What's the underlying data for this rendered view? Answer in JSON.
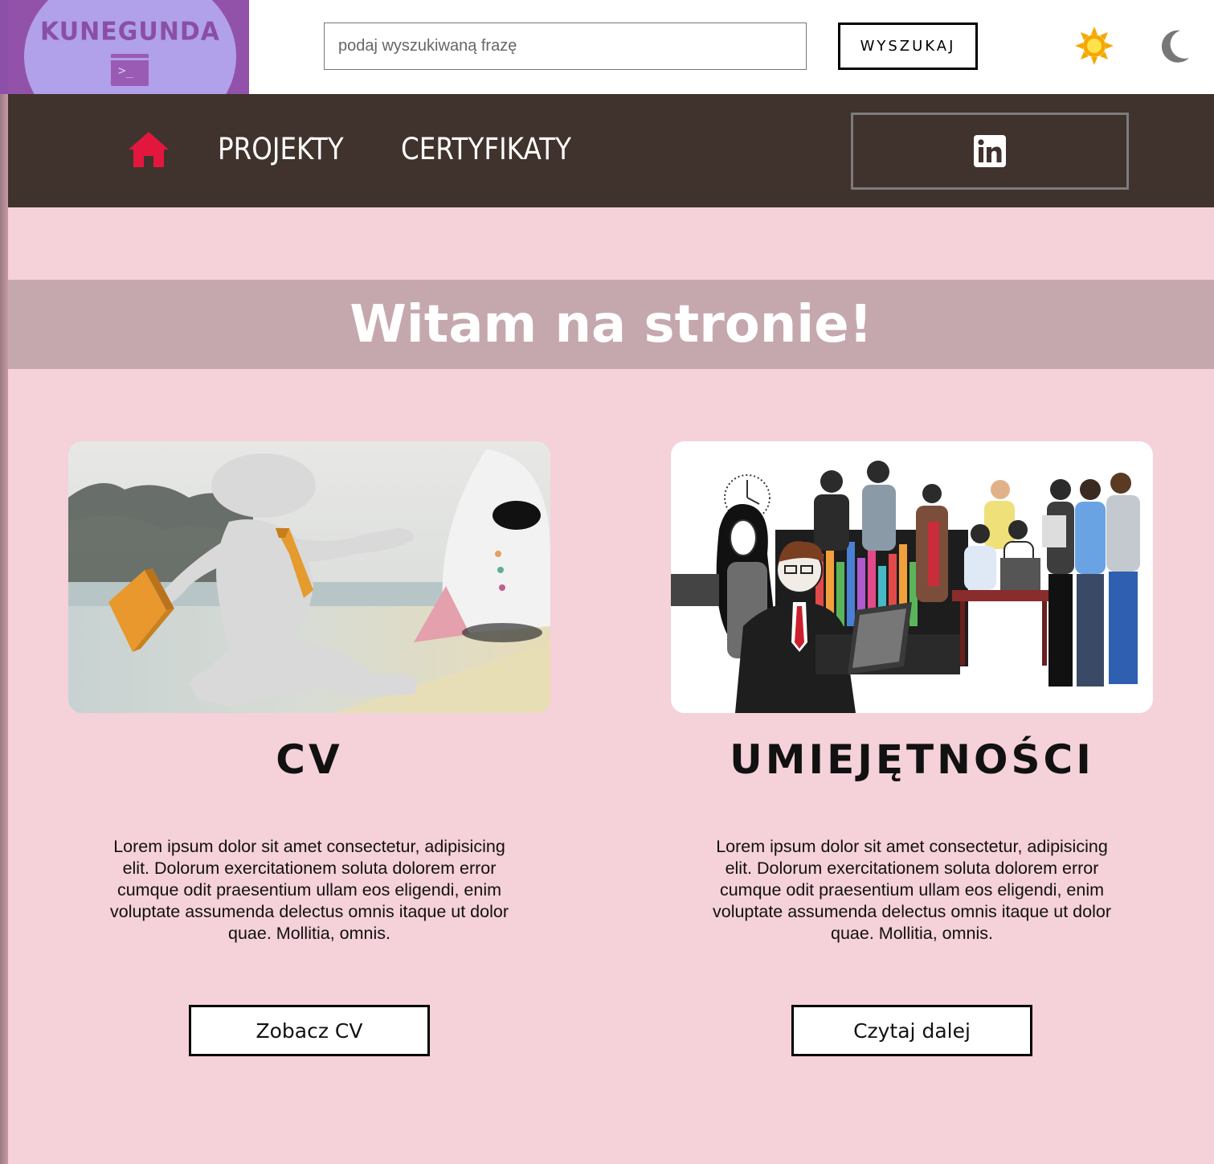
{
  "header": {
    "logo_text": "KUNEGUNDA",
    "logo_icon": "terminal-icon",
    "search": {
      "placeholder": "podaj wyszukiwaną frazę",
      "value": ""
    },
    "search_button_label": "WYSZUKAJ",
    "theme_icons": [
      "sun-icon",
      "moon-icon"
    ]
  },
  "nav": {
    "home_icon": "home-icon",
    "links": [
      {
        "label": "PROJEKTY"
      },
      {
        "label": "CERTYFIKATY"
      }
    ],
    "social_icon": "linkedin-icon"
  },
  "hero": {
    "title": "Witam na stronie!"
  },
  "cards": [
    {
      "title": "CV",
      "text": "Lorem ipsum dolor sit amet consectetur, adipisicing elit. Dolorum exercitationem soluta dolorem error cumque odit praesentium ullam eos eligendi, enim voluptate assumenda delectus omnis itaque ut dolor quae. Mollitia, omnis.",
      "button_label": "Zobacz CV"
    },
    {
      "title": "UMIEJĘTNOŚCI",
      "text": "Lorem ipsum dolor sit amet consectetur, adipisicing elit. Dolorum exercitationem soluta dolorem error cumque odit praesentium ullam eos eligendi, enim voluptate assumenda delectus omnis itaque ut dolor quae. Mollitia, omnis.",
      "button_label": "Czytaj dalej"
    }
  ],
  "colors": {
    "page_background": "#f5d1d9",
    "logo_background": "#9352aa",
    "logo_circle": "#b1a0ea",
    "nav_background": "#40322c",
    "hero_band": "#c5a8ad",
    "home_icon": "#e3173e",
    "sun": "#f5a800",
    "moon": "#777777"
  }
}
